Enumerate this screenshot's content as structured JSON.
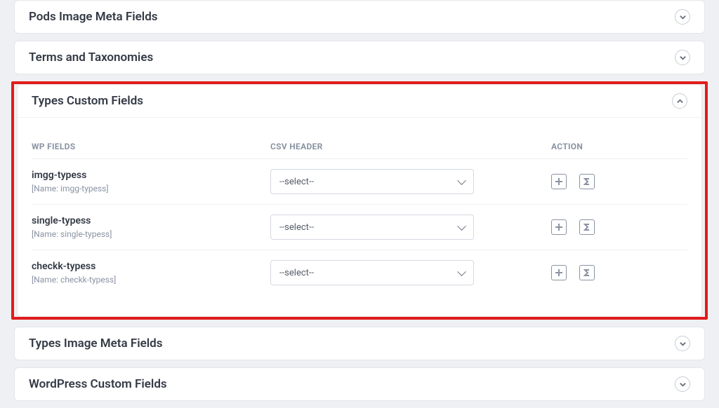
{
  "panels": {
    "pods_meta": {
      "title": "Pods Image Meta Fields"
    },
    "terms_tax": {
      "title": "Terms and Taxonomies"
    },
    "types_custom": {
      "title": "Types Custom Fields"
    },
    "types_meta": {
      "title": "Types Image Meta Fields"
    },
    "wp_custom": {
      "title": "WordPress Custom Fields"
    }
  },
  "columns": {
    "wp": "WP FIELDS",
    "csv": "CSV HEADER",
    "action": "ACTION"
  },
  "select_placeholder": "--select--",
  "rows": [
    {
      "name": "imgg-typess",
      "sub": "[Name: imgg-typess]"
    },
    {
      "name": "single-typess",
      "sub": "[Name: single-typess]"
    },
    {
      "name": "checkk-typess",
      "sub": "[Name: checkk-typess]"
    }
  ]
}
